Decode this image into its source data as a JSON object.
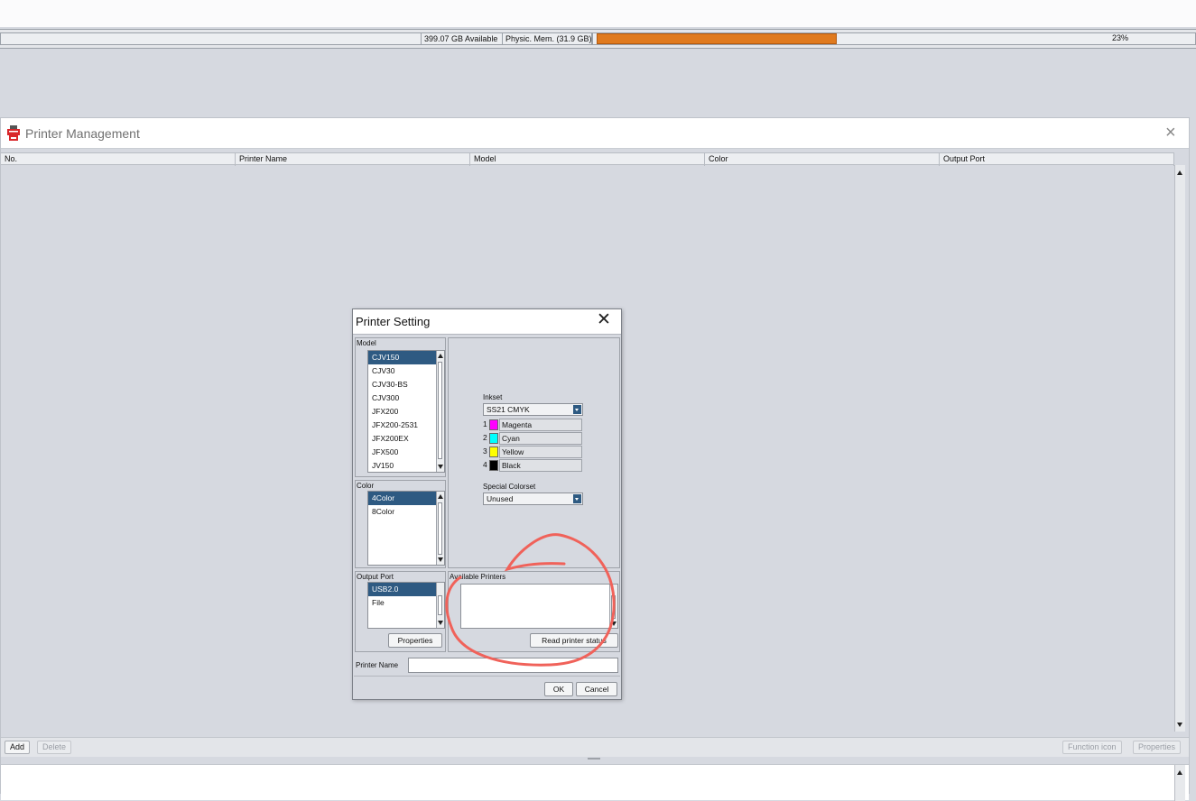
{
  "statusbar": {
    "disk": "399.07 GB Available",
    "mem_label": "Physic. Mem. (31.9 GB)",
    "mem_percent_text": "23%",
    "mem_fraction": 0.23
  },
  "printer_management": {
    "title": "Printer Management",
    "columns": [
      "No.",
      "Printer Name",
      "Model",
      "Color",
      "Output Port"
    ],
    "buttons": {
      "add": "Add",
      "delete": "Delete",
      "function_icon": "Function icon",
      "properties": "Properties"
    }
  },
  "printer_setting": {
    "title": "Printer Setting",
    "model_label": "Model",
    "models": [
      "CJV150",
      "CJV30",
      "CJV30-BS",
      "CJV300",
      "JFX200",
      "JFX200-2531",
      "JFX200EX",
      "JFX500",
      "JV150"
    ],
    "color_label": "Color",
    "colors": [
      "4Color",
      "8Color"
    ],
    "inkset_label": "Inkset",
    "inkset_value": "SS21 CMYK",
    "inks": [
      {
        "num": "1",
        "name": "Magenta",
        "color": "#ff00ff"
      },
      {
        "num": "2",
        "name": "Cyan",
        "color": "#00ffff"
      },
      {
        "num": "3",
        "name": "Yellow",
        "color": "#ffff00"
      },
      {
        "num": "4",
        "name": "Black",
        "color": "#000000"
      }
    ],
    "special_colorset_label": "Special Colorset",
    "special_colorset_value": "Unused",
    "output_port_label": "Output Port",
    "ports": [
      "USB2.0",
      "File"
    ],
    "available_printers_label": "Available Printers",
    "properties_button": "Properties",
    "read_status_button": "Read printer status",
    "printer_name_label": "Printer Name",
    "printer_name_value": "",
    "ok_button": "OK",
    "cancel_button": "Cancel"
  },
  "colors": {
    "selection": "#2e5a82",
    "memory_bar": "#e07a1e",
    "annotation": "#f0625a"
  }
}
